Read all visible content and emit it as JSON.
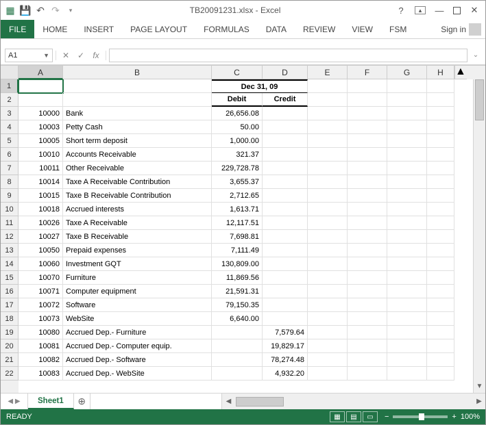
{
  "title": "TB20091231.xlsx - Excel",
  "ribbon": {
    "file": "FILE",
    "tabs": [
      "HOME",
      "INSERT",
      "PAGE LAYOUT",
      "FORMULAS",
      "DATA",
      "REVIEW",
      "VIEW",
      "FSM"
    ],
    "signin": "Sign in"
  },
  "namebox": "A1",
  "fx_label": "fx",
  "columns": [
    "A",
    "B",
    "C",
    "D",
    "E",
    "F",
    "G",
    "H"
  ],
  "header": {
    "date": "Dec 31, 09",
    "debit": "Debit",
    "credit": "Credit"
  },
  "rows": [
    {
      "n": 3,
      "acct": "10000",
      "name": "Bank",
      "debit": "26,656.08",
      "credit": ""
    },
    {
      "n": 4,
      "acct": "10003",
      "name": "Petty Cash",
      "debit": "50.00",
      "credit": ""
    },
    {
      "n": 5,
      "acct": "10005",
      "name": "Short term deposit",
      "debit": "1,000.00",
      "credit": ""
    },
    {
      "n": 6,
      "acct": "10010",
      "name": "Accounts Receivable",
      "debit": "321.37",
      "credit": ""
    },
    {
      "n": 7,
      "acct": "10011",
      "name": "Other Receivable",
      "debit": "229,728.78",
      "credit": ""
    },
    {
      "n": 8,
      "acct": "10014",
      "name": "Taxe A Receivable Contribution",
      "debit": "3,655.37",
      "credit": ""
    },
    {
      "n": 9,
      "acct": "10015",
      "name": "Taxe B Receivable Contribution",
      "debit": "2,712.65",
      "credit": ""
    },
    {
      "n": 10,
      "acct": "10018",
      "name": "Accrued interests",
      "debit": "1,613.71",
      "credit": ""
    },
    {
      "n": 11,
      "acct": "10026",
      "name": "Taxe A Receivable",
      "debit": "12,117.51",
      "credit": ""
    },
    {
      "n": 12,
      "acct": "10027",
      "name": "Taxe B Receivable",
      "debit": "7,698.81",
      "credit": ""
    },
    {
      "n": 13,
      "acct": "10050",
      "name": "Prepaid expenses",
      "debit": "7,111.49",
      "credit": ""
    },
    {
      "n": 14,
      "acct": "10060",
      "name": "Investment GQT",
      "debit": "130,809.00",
      "credit": ""
    },
    {
      "n": 15,
      "acct": "10070",
      "name": "Furniture",
      "debit": "11,869.56",
      "credit": ""
    },
    {
      "n": 16,
      "acct": "10071",
      "name": "Computer equipment",
      "debit": "21,591.31",
      "credit": ""
    },
    {
      "n": 17,
      "acct": "10072",
      "name": "Software",
      "debit": "79,150.35",
      "credit": ""
    },
    {
      "n": 18,
      "acct": "10073",
      "name": "WebSite",
      "debit": "6,640.00",
      "credit": ""
    },
    {
      "n": 19,
      "acct": "10080",
      "name": "Accrued Dep.- Furniture",
      "debit": "",
      "credit": "7,579.64"
    },
    {
      "n": 20,
      "acct": "10081",
      "name": "Accrued Dep.- Computer equip.",
      "debit": "",
      "credit": "19,829.17"
    },
    {
      "n": 21,
      "acct": "10082",
      "name": "Accrued Dep.- Software",
      "debit": "",
      "credit": "78,274.48"
    },
    {
      "n": 22,
      "acct": "10083",
      "name": "Accrued Dep.- WebSite",
      "debit": "",
      "credit": "4,932.20"
    }
  ],
  "sheet": {
    "name": "Sheet1"
  },
  "status": {
    "ready": "READY",
    "zoom": "100%"
  }
}
